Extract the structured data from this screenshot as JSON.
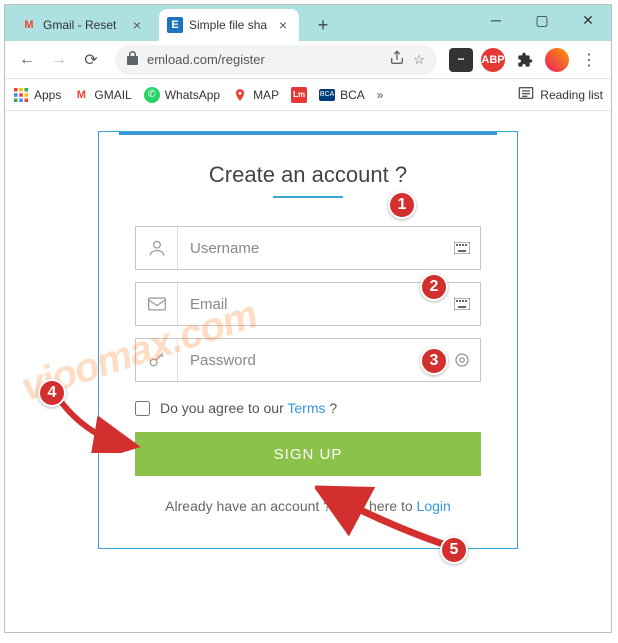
{
  "window": {
    "tabs": [
      {
        "title": "Gmail - Reset",
        "favicon": "M"
      },
      {
        "title": "Simple file sha",
        "favicon": "E"
      }
    ]
  },
  "toolbar": {
    "url": "emload.com/register"
  },
  "bookmarks": {
    "apps": "Apps",
    "gmail": "GMAIL",
    "whatsapp": "WhatsApp",
    "map": "MAP",
    "bca": "BCA",
    "reading_list": "Reading list"
  },
  "form": {
    "title": "Create an account ?",
    "username_placeholder": "Username",
    "email_placeholder": "Email",
    "password_placeholder": "Password",
    "agree_prefix": "Do you agree to our ",
    "terms_label": "Terms",
    "agree_suffix": " ?",
    "signup_label": "SIGN UP",
    "login_prefix": "Already have an account ? Click here to ",
    "login_label": "Login"
  },
  "annotations": {
    "b1": "1",
    "b2": "2",
    "b3": "3",
    "b4": "4",
    "b5": "5"
  },
  "watermark": "vioomax.com"
}
